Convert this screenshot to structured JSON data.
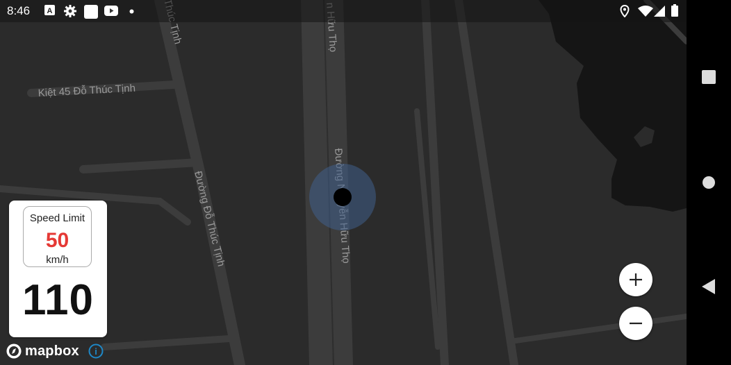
{
  "status_bar": {
    "time": "8:46",
    "icons": [
      "keyboard-a-icon",
      "gear-icon",
      "blank-square-icon",
      "youtube-icon",
      "dot-icon",
      "location-pin-icon",
      "wifi-icon",
      "signal-icon",
      "battery-icon"
    ]
  },
  "map": {
    "streets": [
      "Kiệt 45 Đỗ Thúc Tịnh",
      "Đường Đỗ Thúc Tịnh",
      "Đường Nguyễn Hữu Thọ",
      "n Hữu Thọ",
      "Thúc Tịnh"
    ],
    "colors": {
      "background": "#2b2b2b",
      "road": "#3c3c3c",
      "water": "#151515",
      "label": "#9a9a9a",
      "location_halo": "#3f5f8a"
    }
  },
  "speed_panel": {
    "limit_label": "Speed Limit",
    "limit_value": "50",
    "limit_unit": "km/h",
    "current_speed": "110",
    "limit_color": "#e53935"
  },
  "controls": {
    "zoom_in": "+",
    "zoom_out": "−"
  },
  "attribution": {
    "logo_text": "mapbox",
    "info": "i"
  },
  "nav_bar": {
    "buttons": [
      "recents-icon",
      "home-icon",
      "back-icon"
    ]
  }
}
